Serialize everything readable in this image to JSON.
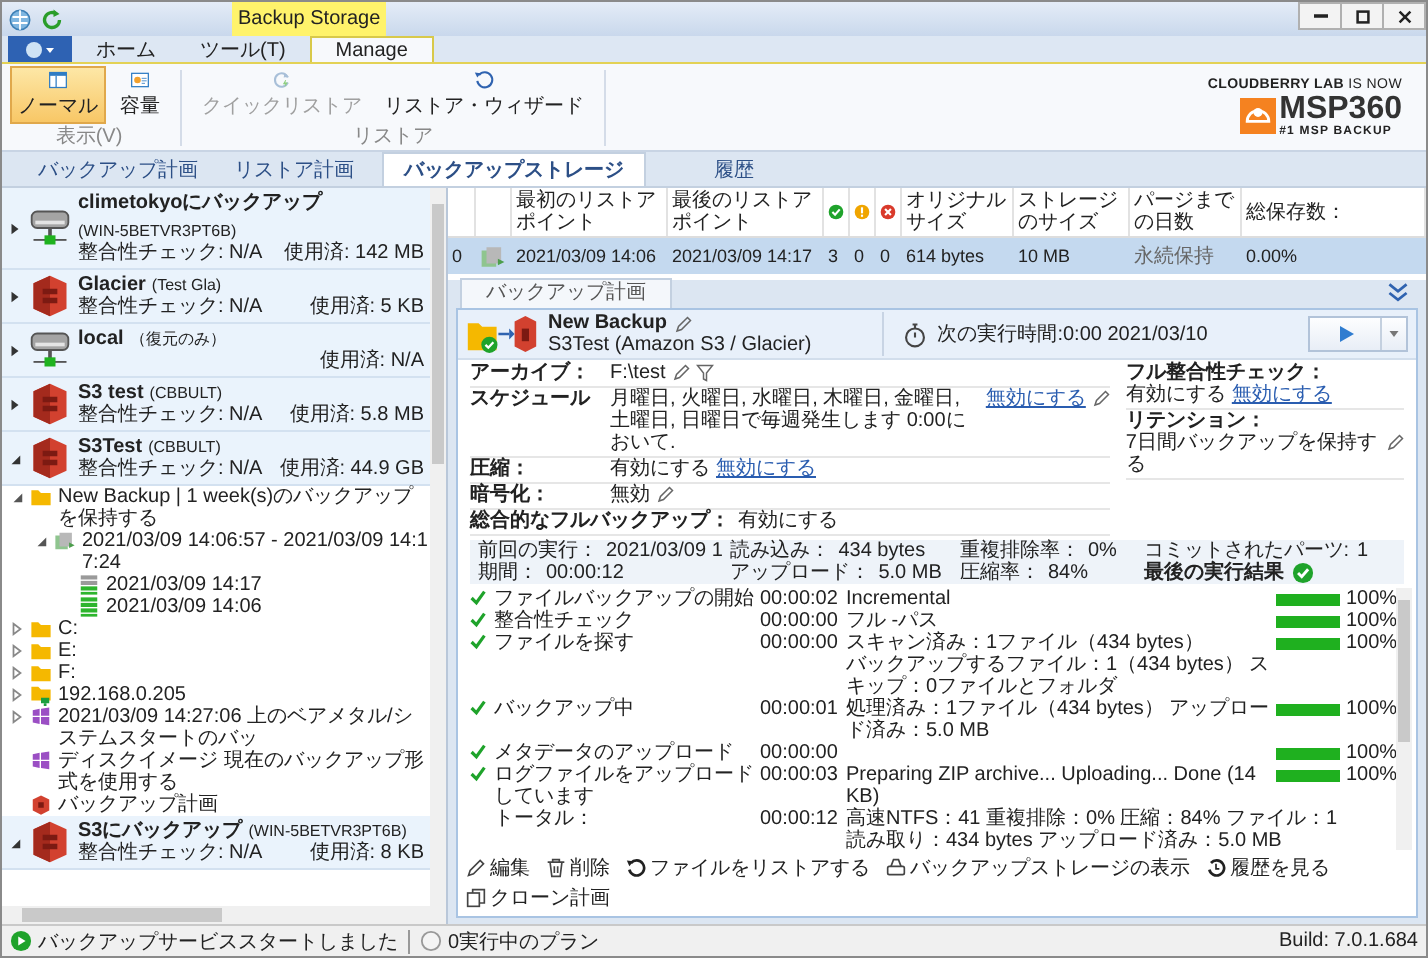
{
  "window": {
    "context_label": "Backup Storage"
  },
  "menu_tabs": [
    {
      "label": "ホーム",
      "selected": false
    },
    {
      "label": "ツール(T)",
      "selected": false
    },
    {
      "label": "Manage",
      "selected": true
    }
  ],
  "ribbon_groups": [
    {
      "label": "表示(V)",
      "buttons": [
        {
          "kind": "layout",
          "label": "ノーマル",
          "selected": true,
          "disabled": false
        },
        {
          "kind": "capacity",
          "label": "容量",
          "selected": false,
          "disabled": false
        }
      ]
    },
    {
      "label": "リストア",
      "buttons": [
        {
          "kind": "quick-restore",
          "label": "クイックリストア",
          "selected": false,
          "disabled": true
        },
        {
          "kind": "restore-wizard",
          "label": "リストア・ウィザード",
          "selected": false,
          "disabled": false
        }
      ]
    }
  ],
  "logo": {
    "tagline": "**CLOUDBERRY LAB** IS NOW",
    "brand": "MSP360",
    "slogan": "#1 MSP BACKUP"
  },
  "main_tabs": [
    {
      "label": "バックアップ計画",
      "selected": false
    },
    {
      "label": "リストア計画",
      "selected": false
    },
    {
      "label": "バックアップストレージ",
      "selected": true
    },
    {
      "label": "履歴",
      "selected": false
    }
  ],
  "storages": [
    {
      "kind": "drive",
      "name": "climetokyoにバックアップ",
      "account": "(WIN-5BETVR3PT6B)",
      "check": "整合性チェック:  N/A",
      "used": "使用済: 142 MB",
      "expanded": false
    },
    {
      "kind": "s3",
      "name": "Glacier",
      "account": "(Test Gla)",
      "check": "整合性チェック:  N/A",
      "used": "使用済: 5 KB",
      "expanded": false
    },
    {
      "kind": "drive",
      "name": "local",
      "account": "（復元のみ）",
      "used": "使用済: N/A",
      "expanded": false
    },
    {
      "kind": "s3",
      "name": "S3 test",
      "account": "(CBBULT)",
      "check": "整合性チェック:  N/A",
      "used": "使用済: 5.8 MB",
      "expanded": false
    },
    {
      "kind": "s3",
      "name": "S3Test",
      "account": "(CBBULT)",
      "check": "整合性チェック:  N/A",
      "used": "使用済: 44.9 GB",
      "expanded": true,
      "children": [
        {
          "kind": "plan",
          "label": "New Backup | 1 week(s)のバックアップを保持する",
          "expanded": true,
          "children": [
            {
              "kind": "version",
              "label": "2021/03/09 14:06:57 - 2021/03/09 14:17:24",
              "expanded": true,
              "children": [
                {
                  "kind": "restore-point-partial",
                  "label": "2021/03/09 14:17"
                },
                {
                  "kind": "restore-point",
                  "label": "2021/03/09 14:06"
                }
              ]
            }
          ]
        },
        {
          "kind": "folder",
          "label": "C:",
          "expanded": false
        },
        {
          "kind": "folder",
          "label": "E:",
          "expanded": false
        },
        {
          "kind": "folder",
          "label": "F:",
          "expanded": false
        },
        {
          "kind": "network-folder",
          "label": "192.168.0.205",
          "expanded": false
        },
        {
          "kind": "image-backup",
          "label": "2021/03/09 14:27:06 上のベアメタル/システムスタートのバッ",
          "expanded": false
        },
        {
          "kind": "image-backup",
          "label": "ディスクイメージ 現在のバックアップ形式を使用する"
        },
        {
          "kind": "plan-s3",
          "label": "バックアップ計画"
        }
      ]
    },
    {
      "kind": "s3",
      "name": "S3にバックアップ",
      "account": "(WIN-5BETVR3PT6B)",
      "check": "整合性チェック:  N/A",
      "used": "使用済: 8 KB",
      "expanded": true
    }
  ],
  "grid": {
    "columns": [
      {
        "kind": "blank"
      },
      {
        "kind": "blank"
      },
      {
        "kind": "text",
        "label": "最初のリストアポイント"
      },
      {
        "kind": "text",
        "label": "最後のリストアポイント"
      },
      {
        "kind": "success"
      },
      {
        "kind": "warning"
      },
      {
        "kind": "error"
      },
      {
        "kind": "text",
        "label": "オリジナルサイズ"
      },
      {
        "kind": "text",
        "label": "ストレージのサイズ"
      },
      {
        "kind": "text",
        "label": "パージまでの日数"
      },
      {
        "kind": "text",
        "label": "総保存数："
      }
    ],
    "rows": [
      {
        "selected": true,
        "cells": [
          {
            "kind": "text",
            "text": "0"
          },
          {
            "kind": "version"
          },
          {
            "kind": "text",
            "text": "2021/03/09 14:06"
          },
          {
            "kind": "text",
            "text": "2021/03/09 14:17"
          },
          {
            "kind": "text",
            "text": "3"
          },
          {
            "kind": "text",
            "text": "0"
          },
          {
            "kind": "text",
            "text": "0"
          },
          {
            "kind": "text",
            "text": "614 bytes"
          },
          {
            "kind": "text",
            "text": "10 MB"
          },
          {
            "kind": "muted",
            "text": "永続保持"
          },
          {
            "kind": "text",
            "text": "0.00%"
          }
        ]
      }
    ]
  },
  "detail_tabs": [
    {
      "label": "バックアップ計画",
      "selected": true
    }
  ],
  "plan": {
    "name": "New Backup",
    "destination": "S3Test (Amazon S3 / Glacier)",
    "next_run": "次の実行時間:0:00 2021/03/10",
    "settings_left": [
      {
        "label": "アーカイブ：",
        "value": "F:\\test",
        "editable": true,
        "filter": true
      },
      {
        "label": "スケジュール",
        "value": "月曜日, 火曜日, 水曜日, 木曜日, 金曜日, 土曜日, 日曜日で毎週発生します 0:00において.",
        "link": "無効にする",
        "editable": true,
        "filter": false
      },
      {
        "label": "圧縮：",
        "value": "有効にする",
        "link": "無効にする",
        "editable": false,
        "filter": false
      },
      {
        "label": "暗号化：",
        "value": "無効",
        "editable": true,
        "filter": false
      },
      {
        "label": "総合的なフルバックアップ：",
        "value": "有効にする",
        "editable": false,
        "filter": false
      }
    ],
    "settings_right": [
      {
        "label": "フル整合性チェック：",
        "value": "有効にする",
        "link": "無効にする",
        "editable": false
      },
      {
        "label": "リテンション：",
        "value": "7日間バックアップを保持する",
        "editable": true
      }
    ],
    "stats": [
      {
        "kind": "text",
        "label": "前回の実行：",
        "value": "2021/03/09 1"
      },
      {
        "kind": "text",
        "label": "期間：",
        "value": "00:00:12"
      },
      {
        "kind": "text",
        "label": "読み込み：",
        "value": "434 bytes"
      },
      {
        "kind": "text",
        "label": "アップロード：",
        "value": "5.0 MB"
      },
      {
        "kind": "text",
        "label": "重複排除率：",
        "value": "0%"
      },
      {
        "kind": "text",
        "label": "圧縮率：",
        "value": "84%"
      },
      {
        "kind": "text",
        "label": "コミットされたパーツ:",
        "value": "1"
      },
      {
        "kind": "result-success",
        "label": "最後の実行結果"
      }
    ],
    "steps": [
      {
        "label": "ファイルバックアップの開始",
        "done": true,
        "time": "00:00:02",
        "detail": [
          "Incremental"
        ],
        "level": 1,
        "percent": "100%"
      },
      {
        "label": "整合性チェック",
        "done": true,
        "time": "00:00:00",
        "detail": [
          "フル -パス"
        ],
        "level": 1,
        "percent": "100%"
      },
      {
        "label": "ファイルを探す",
        "done": true,
        "time": "00:00:00",
        "detail": [
          "スキャン済み：1ファイル（434 bytes）",
          "バックアップするファイル：1（434 bytes） スキップ：0ファイルとフォルダ"
        ],
        "level": 1,
        "percent": "100%"
      },
      {
        "label": "バックアップ中",
        "done": true,
        "time": "00:00:01",
        "detail": [
          "処理済み：1ファイル（434 bytes） アップロード済み：5.0 MB"
        ],
        "level": 1,
        "percent": "100%"
      },
      {
        "label": "メタデータのアップロード",
        "done": true,
        "time": "00:00:00",
        "level": 1,
        "percent": "100%"
      },
      {
        "label": "ログファイルをアップロードしています",
        "done": true,
        "time": "00:00:03",
        "detail": [
          "Preparing ZIP archive... Uploading... Done (14 KB)"
        ],
        "level": 1,
        "percent": "100%"
      }
    ],
    "total": {
      "label": "トータル：",
      "time": "00:00:12",
      "detail": [
        "高速NTFS：41 重複排除：0% 圧縮：84% ファイル：1",
        "読み取り：434 bytes アップロード済み：5.0 MB"
      ]
    },
    "actions": [
      {
        "kind": "edit",
        "label": "編集"
      },
      {
        "kind": "delete",
        "label": "削除"
      },
      {
        "kind": "restore",
        "label": "ファイルをリストアする"
      },
      {
        "kind": "storage",
        "label": "バックアップストレージの表示"
      },
      {
        "kind": "history",
        "label": "履歴を見る"
      },
      {
        "kind": "clone",
        "label": "クローン計画"
      }
    ]
  },
  "status_bar": {
    "service": "バックアップサービススタートしました",
    "service_running": true,
    "plans": "0実行中のプラン",
    "build": "Build: 7.0.1.684"
  }
}
